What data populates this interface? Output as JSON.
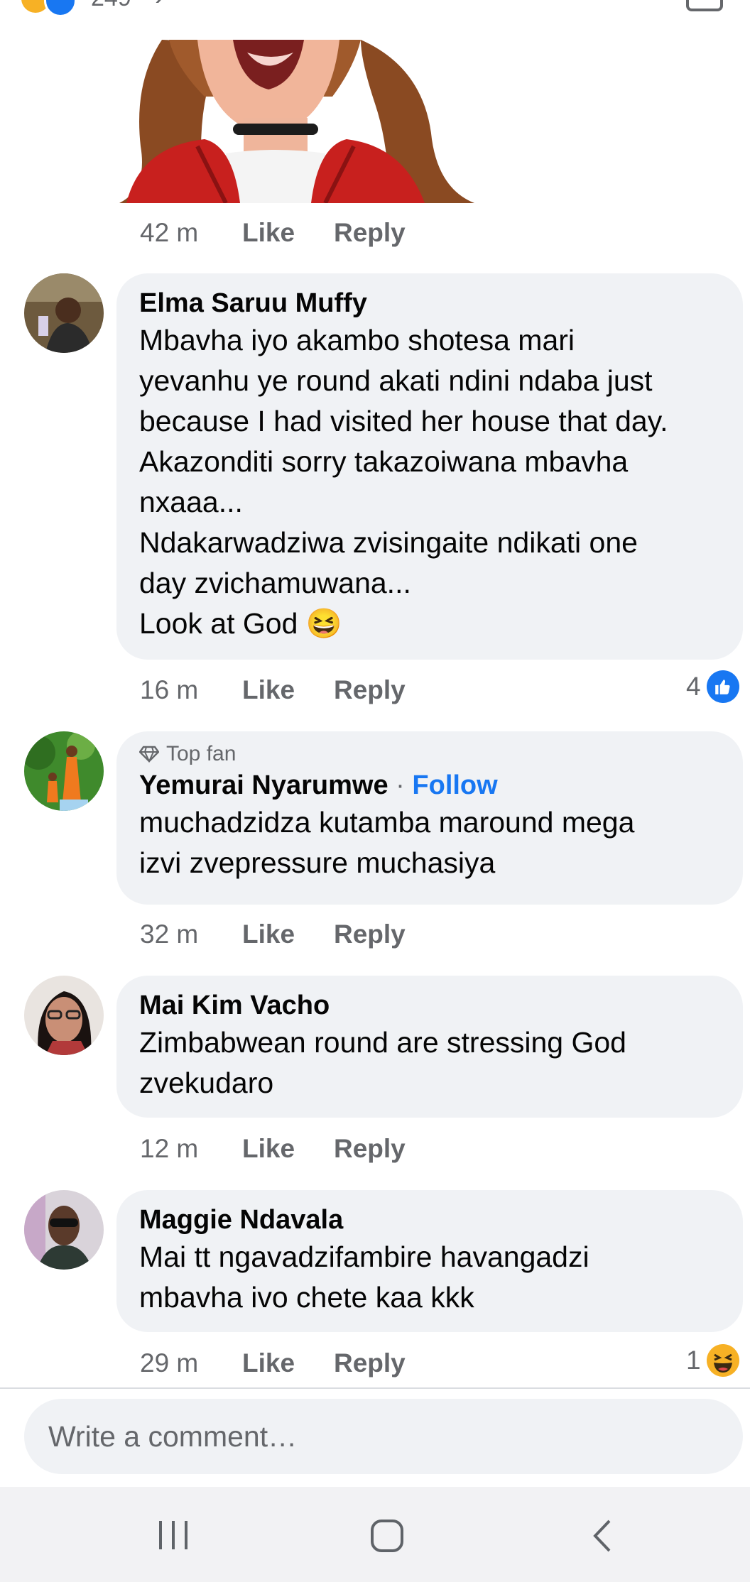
{
  "top": {
    "count_partial": "249",
    "reaction_icons": [
      "haha-icon",
      "like-icon"
    ]
  },
  "colors": {
    "accent": "#1877f2",
    "bubble": "#f0f2f5",
    "meta": "#65676b",
    "haha": "#f7b125"
  },
  "sticker_comment": {
    "time": "42 m",
    "like": "Like",
    "reply": "Reply"
  },
  "comments": [
    {
      "name": "Elma Saruu Muffy",
      "text": "Mbavha iyo akambo shotesa mari\nyevanhu ye round akati ndini ndaba just\nbecause I had visited her house that day.\nAkazonditi sorry takazoiwana mbavha\nnxaaa...\nNdakarwadziwa zvisingaite ndikati one\nday zvichamuwana...\nLook at God 😆",
      "time": "16 m",
      "like": "Like",
      "reply": "Reply",
      "reaction_count": "4",
      "reaction": "like-icon"
    },
    {
      "badge": "Top fan",
      "name": "Yemurai Nyarumwe",
      "separator": "·",
      "follow": "Follow",
      "text": "muchadzidza kutamba maround mega\nizvi zvepressure muchasiya",
      "time": "32 m",
      "like": "Like",
      "reply": "Reply"
    },
    {
      "name": "Mai Kim Vacho",
      "text": "Zimbabwean round are stressing God\nzvekudaro",
      "time": "12 m",
      "like": "Like",
      "reply": "Reply"
    },
    {
      "name": "Maggie Ndavala",
      "text": "Mai tt ngavadzifambire havangadzi\nmbavha ivo chete kaa kkk",
      "time": "29 m",
      "like": "Like",
      "reply": "Reply",
      "reaction_count": "1",
      "reaction": "haha-icon"
    }
  ],
  "composer": {
    "placeholder": "Write a comment…"
  },
  "navbar": {
    "icons": [
      "recent-apps-icon",
      "home-icon",
      "back-icon"
    ]
  }
}
